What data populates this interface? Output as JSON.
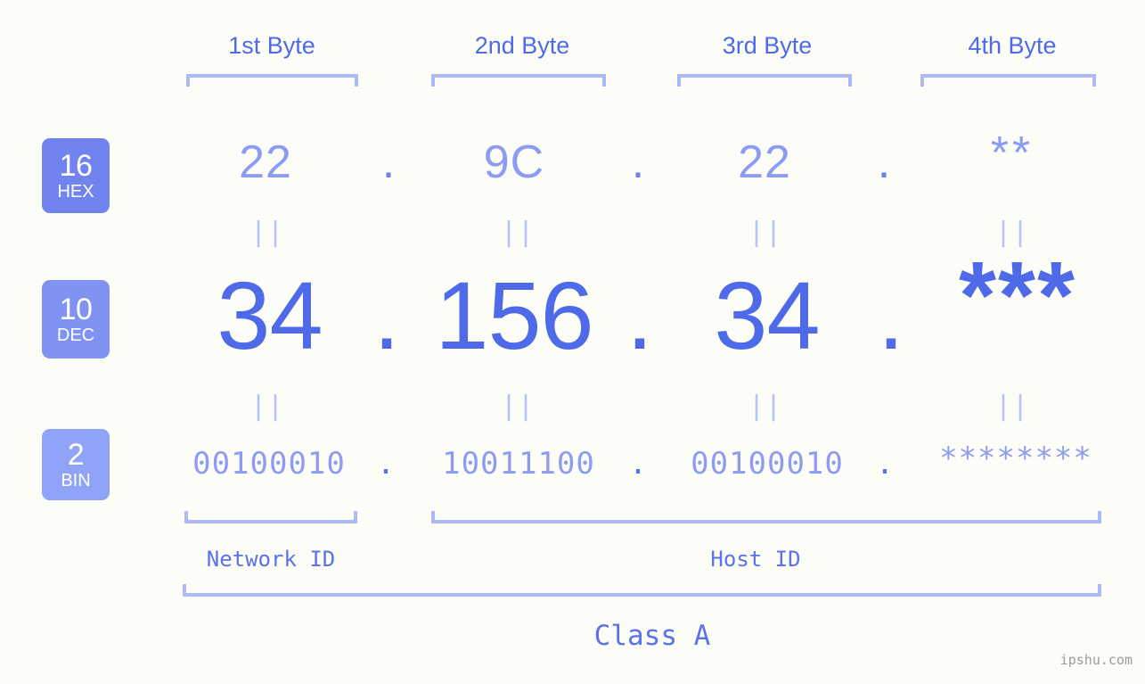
{
  "theme": {
    "background": "#fdfdf8",
    "accent_strong": "#4f6ae8",
    "accent_mid": "#8d9cf2",
    "accent_light": "#aeb9f7",
    "badge_hex": "#7183ee",
    "badge_dec": "#8093f2",
    "badge_bin": "#8fa3f8",
    "watermark_color": "#9b9b9b"
  },
  "byte_headers": [
    {
      "label": "1st Byte"
    },
    {
      "label": "2nd Byte"
    },
    {
      "label": "3rd Byte"
    },
    {
      "label": "4th Byte"
    }
  ],
  "radix_badges": [
    {
      "number": "16",
      "name": "HEX"
    },
    {
      "number": "10",
      "name": "DEC"
    },
    {
      "number": "2",
      "name": "BIN"
    }
  ],
  "rows": {
    "hex": {
      "radix": "16",
      "name": "HEX",
      "values": [
        "22",
        "9C",
        "22",
        "**"
      ],
      "separator": "."
    },
    "dec": {
      "radix": "10",
      "name": "DEC",
      "values": [
        "34",
        "156",
        "34",
        "***"
      ],
      "separator": "."
    },
    "bin": {
      "radix": "2",
      "name": "BIN",
      "values": [
        "00100010",
        "10011100",
        "00100010",
        "********"
      ],
      "separator": "."
    }
  },
  "equality_marks": {
    "glyph": "||",
    "count_per_row": 4
  },
  "segments": {
    "network_id": "Network ID",
    "host_id": "Host ID",
    "class": "Class A"
  },
  "watermark": "ipshu.com"
}
